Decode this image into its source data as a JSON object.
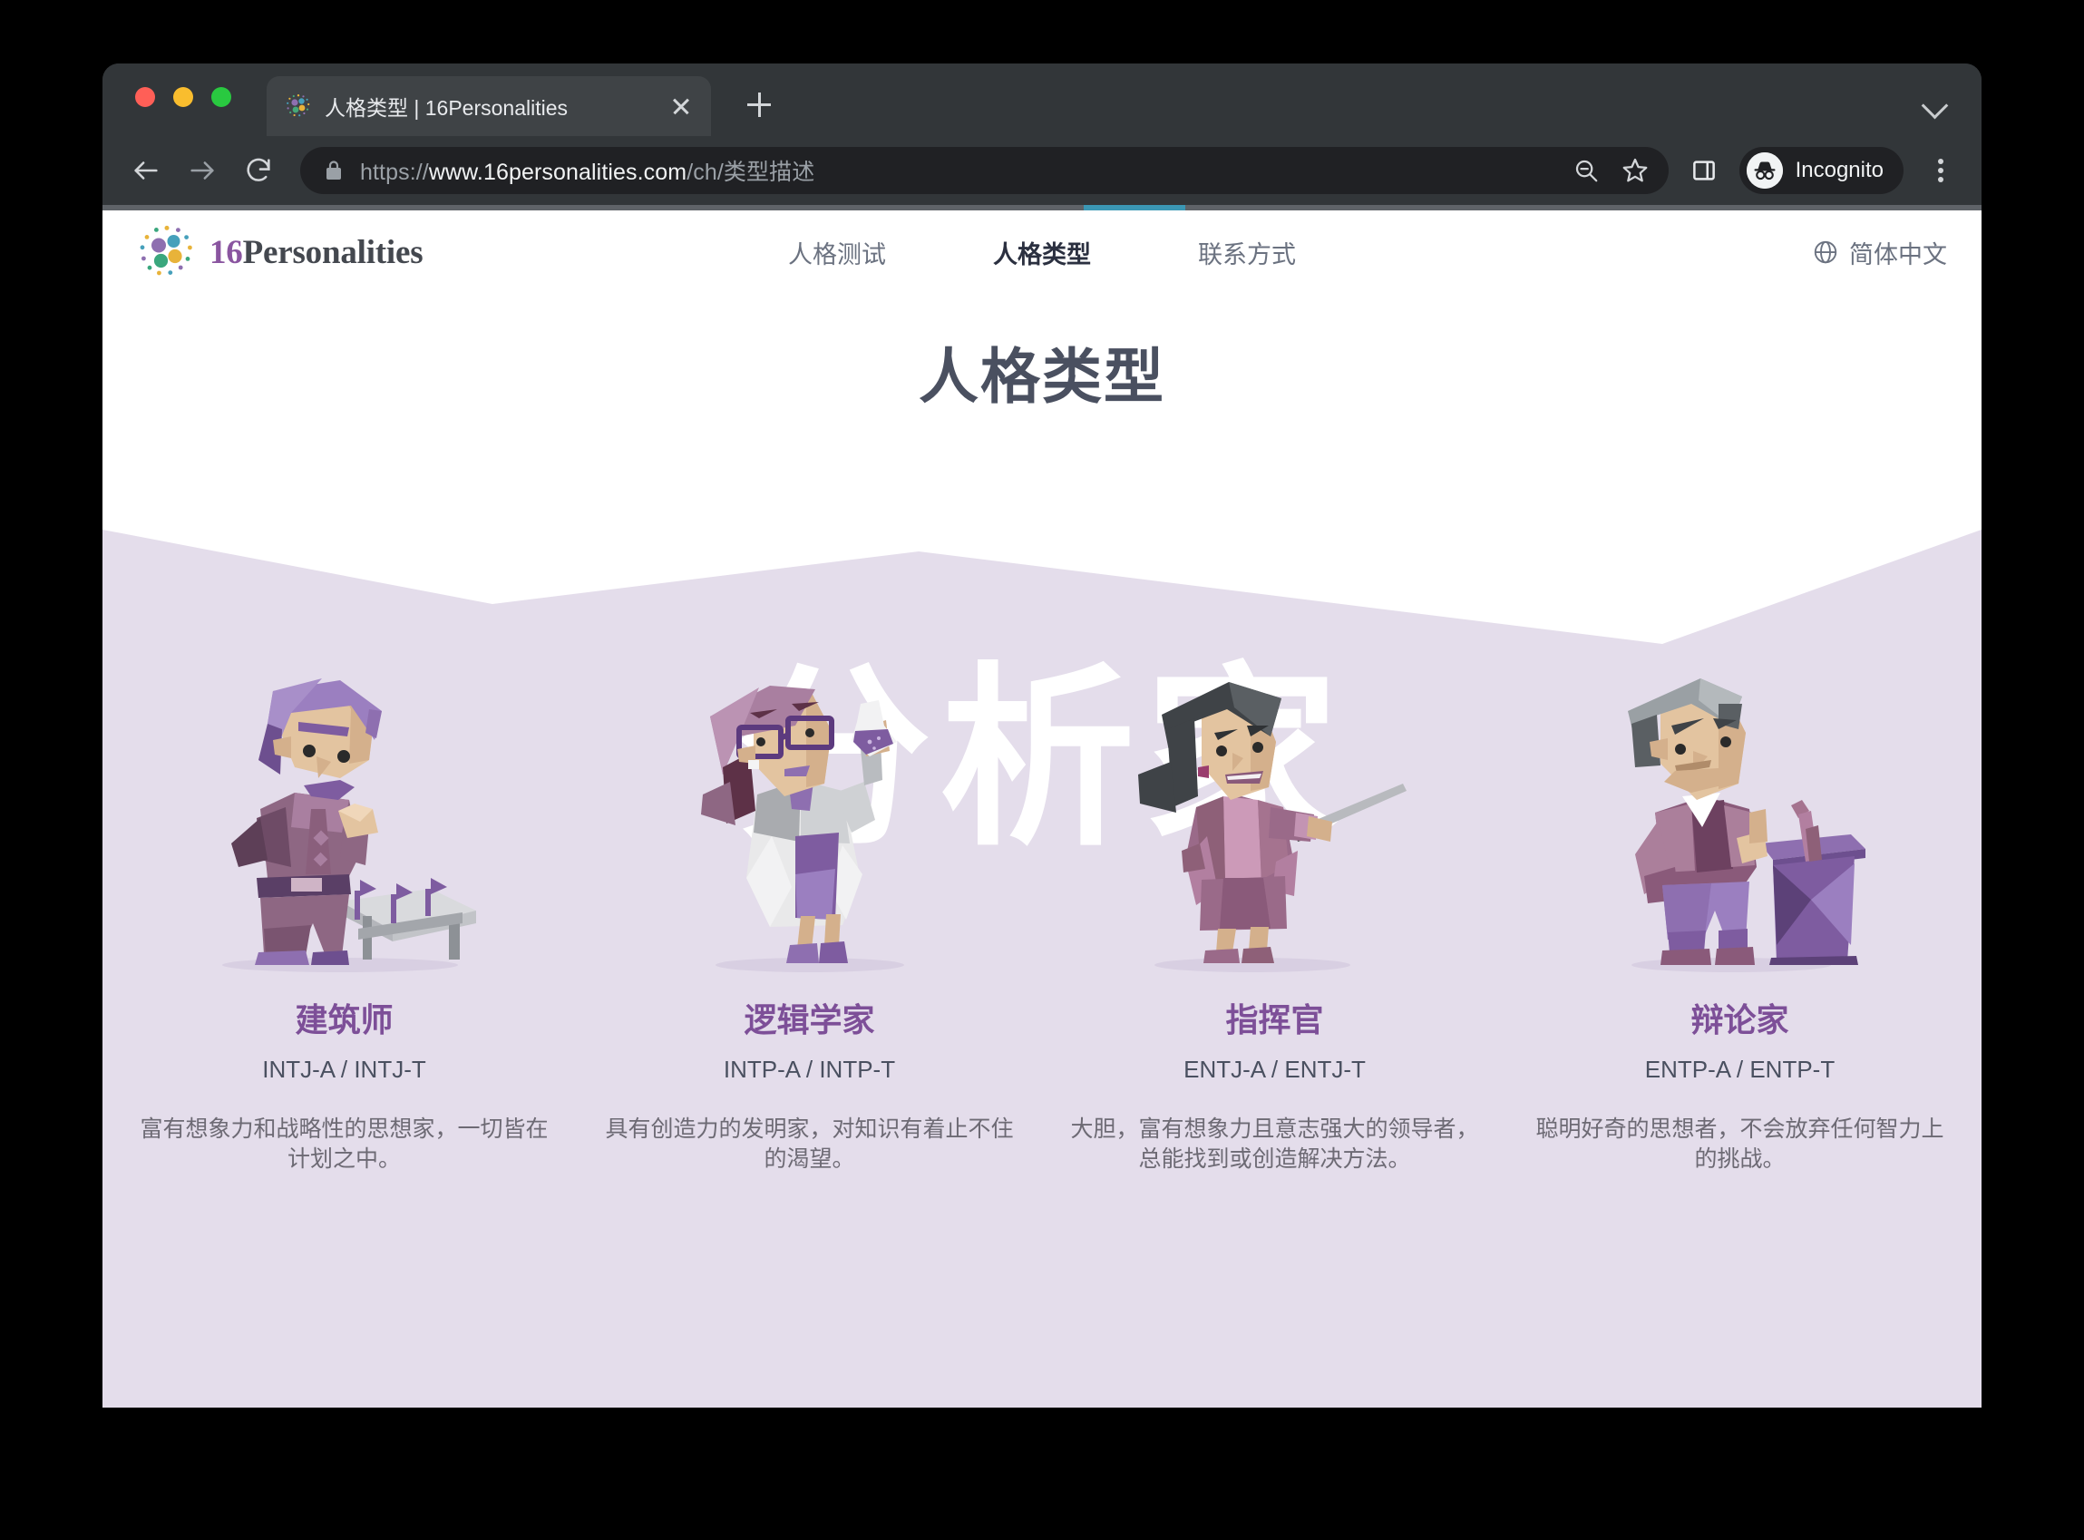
{
  "browser": {
    "tab": {
      "title": "人格类型 | 16Personalities",
      "favicon_icon": "16personalities-dots-icon",
      "close_icon": "close-icon"
    },
    "new_tab_icon": "plus-icon",
    "window_chevron_icon": "chevron-down-icon",
    "toolbar": {
      "back_icon": "back-arrow-icon",
      "forward_icon": "forward-arrow-icon",
      "reload_icon": "reload-icon",
      "lock_icon": "lock-icon",
      "url_scheme": "https://",
      "url_host": "www.16personalities.com",
      "url_path": "/ch/类型描述",
      "zoom_out_icon": "zoom-out-icon",
      "bookmark_icon": "star-icon",
      "side_panel_icon": "side-panel-icon",
      "profile_icon": "incognito-avatar-icon",
      "profile_label": "Incognito",
      "menu_icon": "kebab-menu-icon"
    },
    "progress": {
      "accent": "#3b97b4"
    }
  },
  "site": {
    "brand": {
      "number": "16",
      "name": "Personalities",
      "logo_icon": "dots-circle-logo-icon"
    },
    "nav": [
      {
        "label": "人格测试",
        "active": false
      },
      {
        "label": "人格类型",
        "active": true
      },
      {
        "label": "联系方式",
        "active": false
      }
    ],
    "language": {
      "icon": "globe-icon",
      "label": "简体中文"
    },
    "page_title": "人格类型",
    "group_watermark": "分析家",
    "colors": {
      "lavender_bg": "#e4ddeb",
      "title_purple": "#7d4f98",
      "heading_slate": "#4a5060"
    },
    "cards": [
      {
        "name": "建筑师",
        "code": "INTJ-A / INTJ-T",
        "description": "富有想象力和战略性的思想家，一切皆在计划之中。",
        "art_icon": "architect-character-icon"
      },
      {
        "name": "逻辑学家",
        "code": "INTP-A / INTP-T",
        "description": "具有创造力的发明家，对知识有着止不住的渴望。",
        "art_icon": "logician-character-icon"
      },
      {
        "name": "指挥官",
        "code": "ENTJ-A / ENTJ-T",
        "description": "大胆，富有想象力且意志强大的领导者，总能找到或创造解决方法。",
        "art_icon": "commander-character-icon"
      },
      {
        "name": "辩论家",
        "code": "ENTP-A / ENTP-T",
        "description": "聪明好奇的思想者，不会放弃任何智力上的挑战。",
        "art_icon": "debater-character-icon"
      }
    ]
  }
}
